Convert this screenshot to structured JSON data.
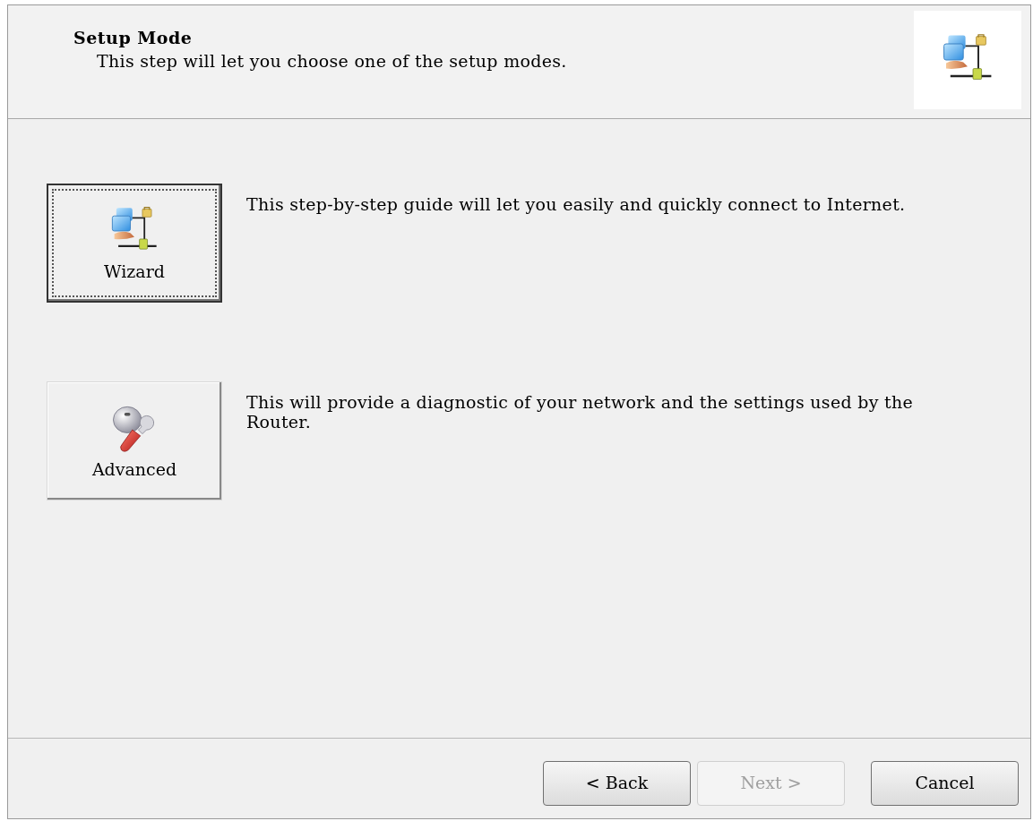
{
  "header": {
    "title": "Setup Mode",
    "subtitle": "This step will let you choose one of the setup modes."
  },
  "modes": [
    {
      "kind": "network",
      "label": "Wizard",
      "description": "This step-by-step guide will let you easily and quickly connect to Internet.",
      "focused": true
    },
    {
      "kind": "tools",
      "label": "Advanced",
      "description": "This will provide a diagnostic of your network and the settings used by the Router.",
      "focused": false
    }
  ],
  "buttons": [
    {
      "label": "< Back",
      "disabled": false
    },
    {
      "label": "Next >",
      "disabled": true
    },
    {
      "label": "Cancel",
      "disabled": false
    }
  ]
}
